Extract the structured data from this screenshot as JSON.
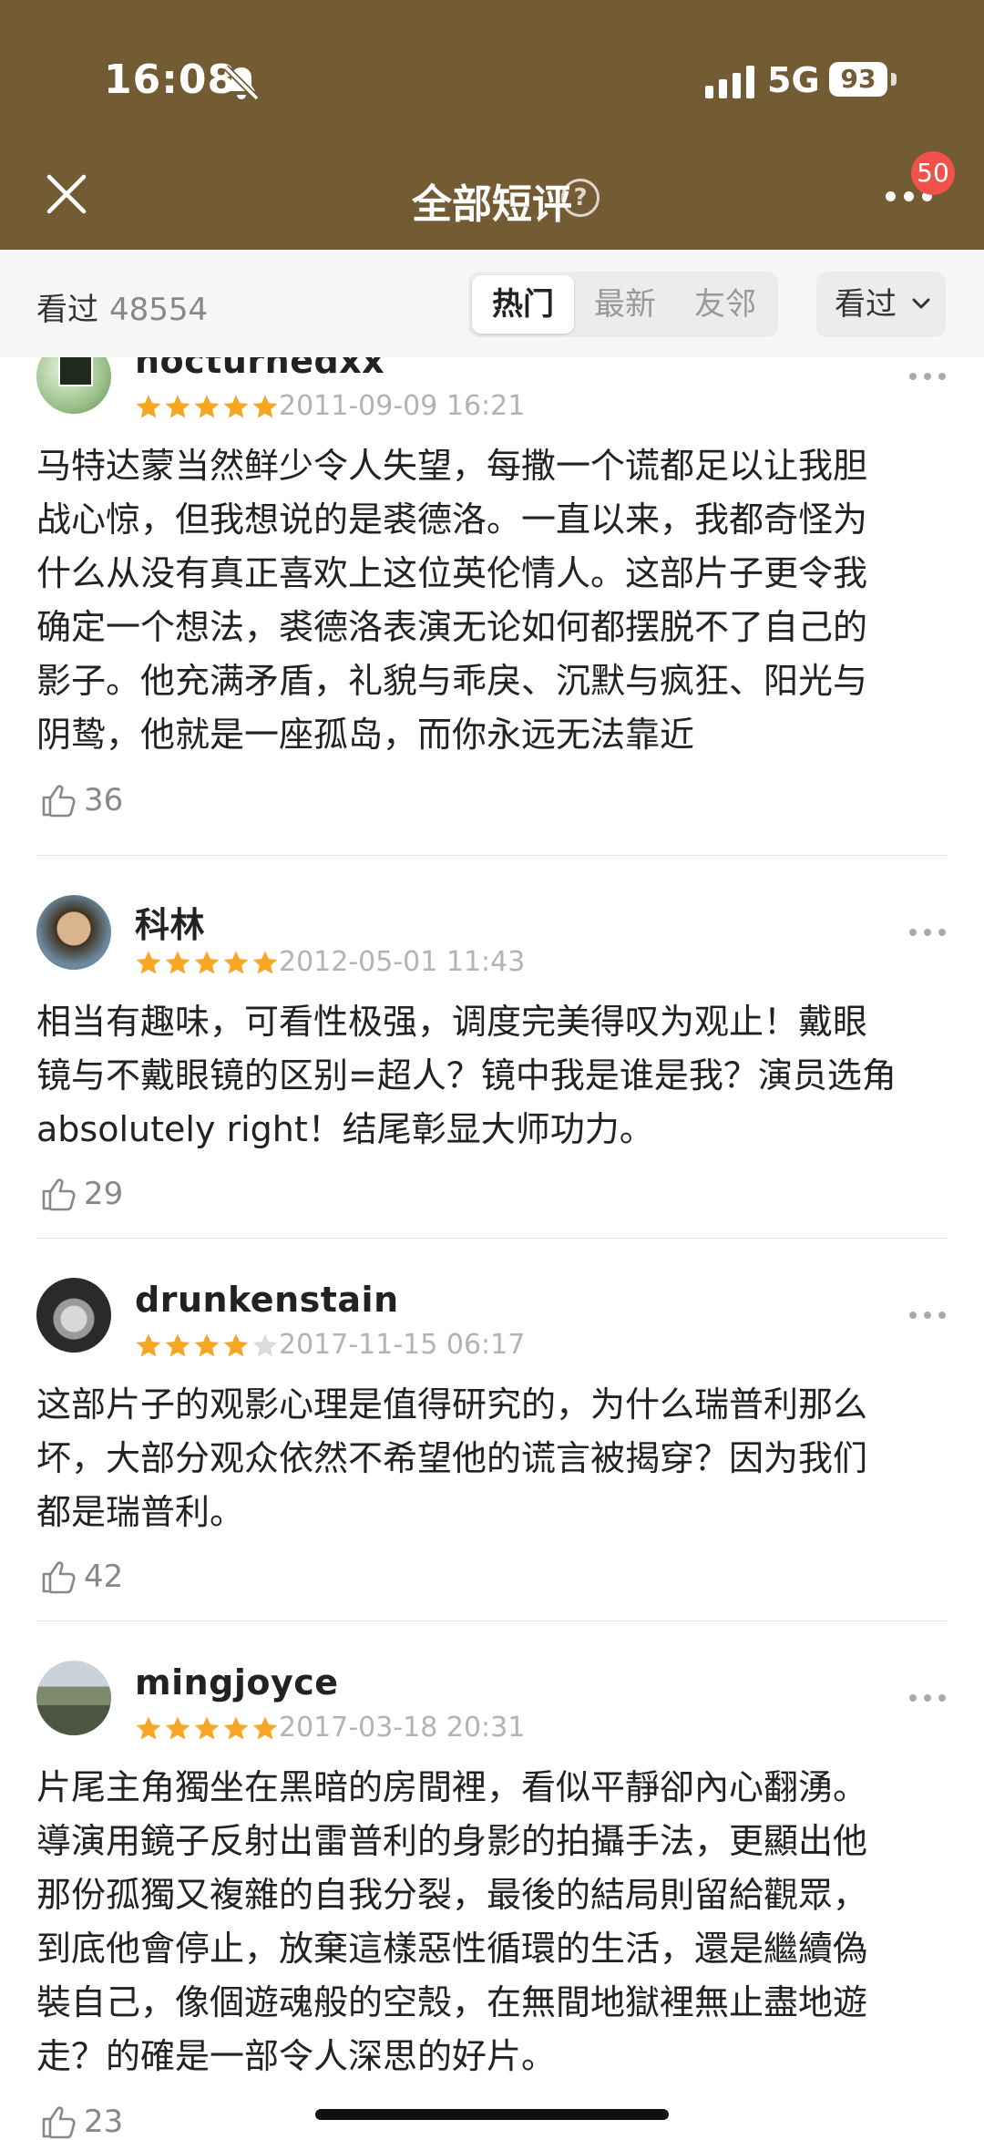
{
  "status_bar": {
    "time": "16:08",
    "network": "5G",
    "battery": "93"
  },
  "header": {
    "title": "全部短评",
    "badge": "50"
  },
  "filter": {
    "seen_label": "看过",
    "seen_count": "48554",
    "tabs": [
      {
        "label": "热门",
        "active": true
      },
      {
        "label": "最新",
        "active": false
      },
      {
        "label": "友邻",
        "active": false
      }
    ],
    "dropdown_label": "看过"
  },
  "comments": [
    {
      "user": "nocturnedxx",
      "rating": 5,
      "date": "2011-09-09 16:21",
      "lines": [
        "马特达蒙当然鲜少令人失望，每撒一个谎都足以让我胆",
        "战心惊，但我想说的是裘德洛。一直以来，我都奇怪为",
        "什么从没有真正喜欢上这位英伦情人。这部片子更令我",
        "确定一个想法，裘德洛表演无论如何都摆脱不了自己的",
        "影子。他充满矛盾，礼貌与乖戾、沉默与疯狂、阳光与",
        "阴鸷，他就是一座孤岛，而你永远无法靠近"
      ],
      "likes": "36"
    },
    {
      "user": "科林",
      "rating": 5,
      "date": "2012-05-01 11:43",
      "lines": [
        "相当有趣味，可看性极强，调度完美得叹为观止！戴眼",
        "镜与不戴眼镜的区别=超人？镜中我是谁是我？演员选角",
        "absolutely right！结尾彰显大师功力。"
      ],
      "likes": "29"
    },
    {
      "user": "drunkenstain",
      "rating": 4,
      "date": "2017-11-15 06:17",
      "lines": [
        "这部片子的观影心理是值得研究的，为什么瑞普利那么",
        "坏，大部分观众依然不希望他的谎言被揭穿？因为我们",
        "都是瑞普利。"
      ],
      "likes": "42"
    },
    {
      "user": "mingjoyce",
      "rating": 5,
      "date": "2017-03-18 20:31",
      "lines": [
        "片尾主角獨坐在黑暗的房間裡，看似平靜卻內心翻湧。",
        "導演用鏡子反射出雷普利的身影的拍攝手法，更顯出他",
        "那份孤獨又複雜的自我分裂，最後的結局則留給觀眾，",
        "到底他會停止，放棄這樣惡性循環的生活，還是繼續偽",
        "裝自己，像個遊魂般的空殼，在無間地獄裡無止盡地遊",
        "走？的確是一部令人深思的好片。"
      ],
      "likes": "23"
    }
  ]
}
